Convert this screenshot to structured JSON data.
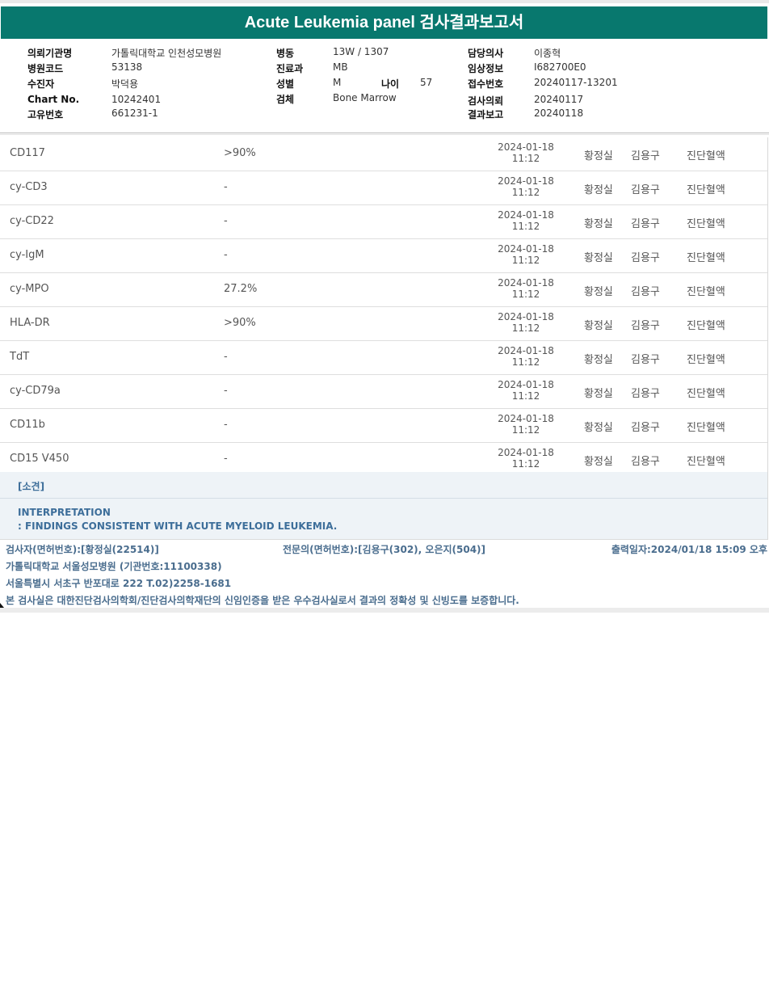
{
  "title": "Acute Leukemia panel 검사결과보고서",
  "header": {
    "col1": [
      {
        "label": "의뢰기관명",
        "value": "가톨릭대학교 인천성모병원"
      },
      {
        "label": "병원코드",
        "value": "53138"
      },
      {
        "label": "수진자",
        "value": "박덕용"
      },
      {
        "label": "Chart No.",
        "value": "10242401"
      },
      {
        "label": "고유번호",
        "value": "661231-1"
      }
    ],
    "col2": [
      {
        "label": "병동",
        "value": "13W / 1307"
      },
      {
        "label": "진료과",
        "value": "MB"
      },
      {
        "label": "성별",
        "value": "M"
      },
      {
        "label": "검체",
        "value": "Bone Marrow"
      }
    ],
    "age": {
      "label": "나이",
      "value": "57"
    },
    "col3": [
      {
        "label": "담당의사",
        "value": "이종혁"
      },
      {
        "label": "임상정보",
        "value": "I682700E0"
      },
      {
        "label": "접수번호",
        "value": "20240117-13201"
      },
      {
        "label": "검사의뢰",
        "value": "20240117"
      },
      {
        "label": "결과보고",
        "value": "20240118"
      }
    ]
  },
  "results": [
    {
      "name": "CD117",
      "value": ">90%",
      "date": "2024-01-18",
      "time": "11:12",
      "tech": "황정실",
      "doctor": "김용구",
      "dept": "진단혈액"
    },
    {
      "name": "cy-CD3",
      "value": "-",
      "date": "2024-01-18",
      "time": "11:12",
      "tech": "황정실",
      "doctor": "김용구",
      "dept": "진단혈액"
    },
    {
      "name": "cy-CD22",
      "value": "-",
      "date": "2024-01-18",
      "time": "11:12",
      "tech": "황정실",
      "doctor": "김용구",
      "dept": "진단혈액"
    },
    {
      "name": "cy-IgM",
      "value": "-",
      "date": "2024-01-18",
      "time": "11:12",
      "tech": "황정실",
      "doctor": "김용구",
      "dept": "진단혈액"
    },
    {
      "name": "cy-MPO",
      "value": "27.2%",
      "date": "2024-01-18",
      "time": "11:12",
      "tech": "황정실",
      "doctor": "김용구",
      "dept": "진단혈액"
    },
    {
      "name": "HLA-DR",
      "value": ">90%",
      "date": "2024-01-18",
      "time": "11:12",
      "tech": "황정실",
      "doctor": "김용구",
      "dept": "진단혈액"
    },
    {
      "name": "TdT",
      "value": "-",
      "date": "2024-01-18",
      "time": "11:12",
      "tech": "황정실",
      "doctor": "김용구",
      "dept": "진단혈액"
    },
    {
      "name": "cy-CD79a",
      "value": "-",
      "date": "2024-01-18",
      "time": "11:12",
      "tech": "황정실",
      "doctor": "김용구",
      "dept": "진단혈액"
    },
    {
      "name": "CD11b",
      "value": "-",
      "date": "2024-01-18",
      "time": "11:12",
      "tech": "황정실",
      "doctor": "김용구",
      "dept": "진단혈액"
    },
    {
      "name": "CD15 V450",
      "value": "-",
      "date": "2024-01-18",
      "time": "11:12",
      "tech": "황정실",
      "doctor": "김용구",
      "dept": "진단혈액"
    }
  ],
  "opinion": {
    "title": "[소견]",
    "line1": "INTERPRETATION",
    "line2": ": FINDINGS CONSISTENT WITH ACUTE MYELOID LEUKEMIA."
  },
  "footer": {
    "tester": "검사자(면허번호):[황정실(22514)]",
    "specialist": "전문의(면허번호):[김용구(302), 오은지(504)]",
    "printed": "출력일자:2024/01/18 15:09 오후",
    "institution": "가톨릭대학교 서울성모병원 (기관번호:11100338)",
    "address": "서울특별시 서초구 반포대로 222 T.02)2258-1681",
    "certification": "본 검사실은 대한진단검사의학회/진단검사의학재단의 신임인증을 받은 우수검사실로서 결과의 정확성 및 신빙도를 보증합니다."
  }
}
